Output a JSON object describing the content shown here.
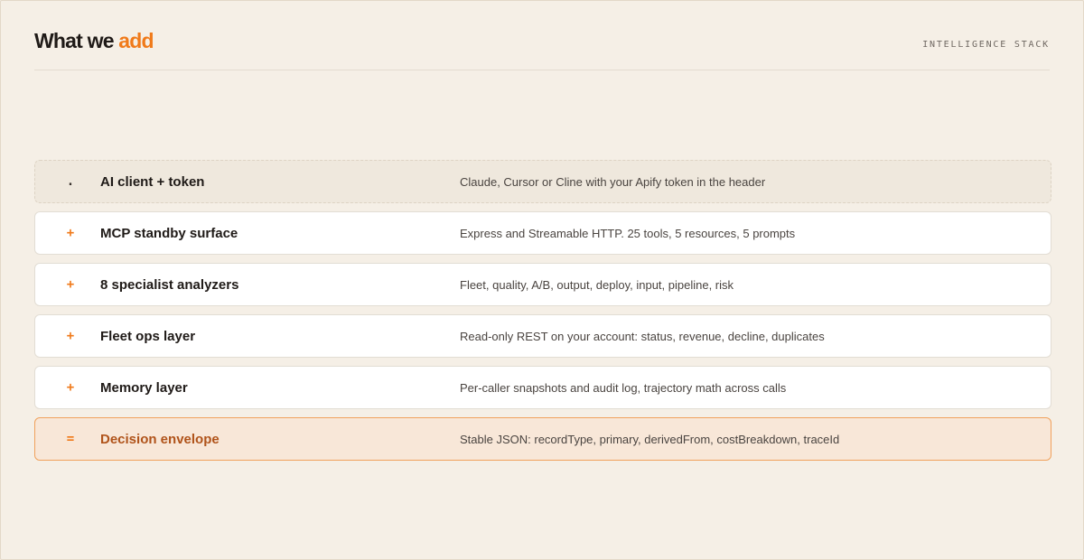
{
  "header": {
    "title_main": "What we",
    "title_accent": "add",
    "tag": "INTELLIGENCE STACK"
  },
  "colors": {
    "accent": "#f07a1a",
    "background": "#f5efe6",
    "highlight_bg": "#f8e7d8",
    "highlight_text": "#b0531a"
  },
  "rows": [
    {
      "symbol": ".",
      "label": "AI client + token",
      "description": "Claude, Cursor or Cline with your Apify token in the header"
    },
    {
      "symbol": "+",
      "label": "MCP standby surface",
      "description": "Express and Streamable HTTP. 25 tools, 5 resources, 5 prompts"
    },
    {
      "symbol": "+",
      "label": "8 specialist analyzers",
      "description": "Fleet, quality, A/B, output, deploy, input, pipeline, risk"
    },
    {
      "symbol": "+",
      "label": "Fleet ops layer",
      "description": "Read-only REST on your account: status, revenue, decline, duplicates"
    },
    {
      "symbol": "+",
      "label": "Memory layer",
      "description": "Per-caller snapshots and audit log, trajectory math across calls"
    },
    {
      "symbol": "=",
      "label": "Decision envelope",
      "description": "Stable JSON: recordType, primary, derivedFrom, costBreakdown, traceId"
    }
  ]
}
